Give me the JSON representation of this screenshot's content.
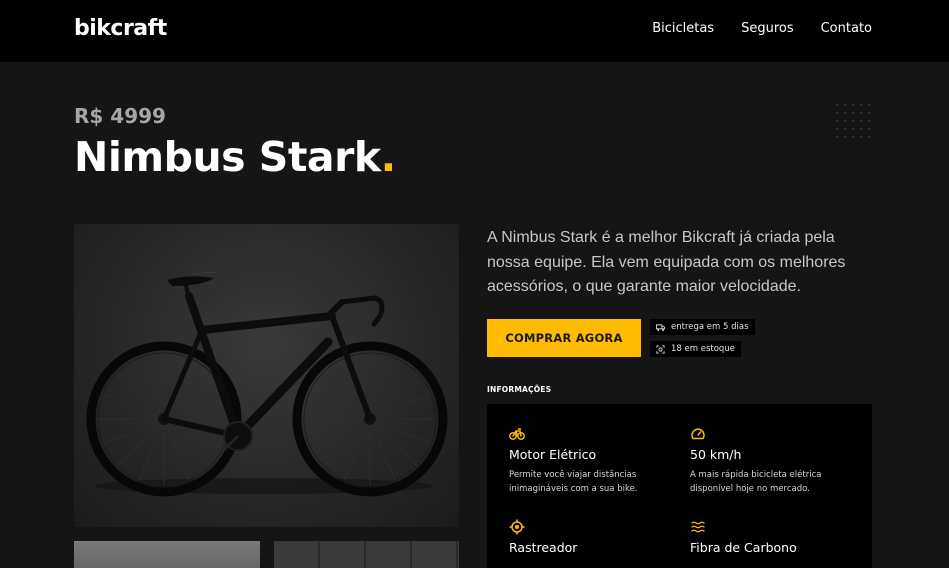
{
  "header": {
    "logo": "bikcraft",
    "nav": [
      {
        "label": "Bicicletas"
      },
      {
        "label": "Seguros"
      },
      {
        "label": "Contato"
      }
    ]
  },
  "product": {
    "price": "R$ 4999",
    "name": "Nimbus Stark",
    "name_dot": ".",
    "description": "A Nimbus Stark é a melhor Bikcraft já criada pela nossa equipe. Ela vem equipada com os melhores acessórios, o que garante maior velocidade.",
    "image_alt": "Bicicleta Nimbus Stark"
  },
  "purchase": {
    "button_label": "COMPRAR AGORA",
    "delivery": "entrega em 5 dias",
    "stock": "18 em estoque"
  },
  "info": {
    "label": "INFORMAÇÕES",
    "features": [
      {
        "icon": "bike-icon",
        "name": "Motor Elétrico",
        "desc": "Permite você viajar distâncias inimagináveis com a sua bike."
      },
      {
        "icon": "speedometer-icon",
        "name": "50 km/h",
        "desc": "A mais rápida bicicleta elétrica disponível hoje no mercado."
      },
      {
        "icon": "target-icon",
        "name": "Rastreador",
        "desc": ""
      },
      {
        "icon": "waves-icon",
        "name": "Fibra de Carbono",
        "desc": ""
      }
    ]
  },
  "colors": {
    "accent": "#ffbb00",
    "background": "#151515",
    "header": "#000000",
    "muted_text": "#a6a6a6"
  }
}
